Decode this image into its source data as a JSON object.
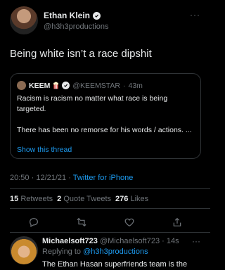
{
  "tweet": {
    "author_name": "Ethan Klein",
    "author_handle": "@h3h3productions",
    "more_icon": "more-icon",
    "text": "Being white isn’t a race dipshit",
    "quoted": {
      "author_name": "KEEM",
      "author_handle": "@KEEMSTAR",
      "separator": "·",
      "time": "43m",
      "line1": "Racism is racism no matter what race is being targeted.",
      "line2": "There has been no remorse for his words / actions. ...",
      "show_thread": "Show this thread"
    },
    "time": "20:50",
    "date": "12/21/21",
    "client": "Twitter for iPhone",
    "retweets_count": "15",
    "retweets_label": "Retweets",
    "quotes_count": "2",
    "quotes_label": "Quote Tweets",
    "likes_count": "276",
    "likes_label": "Likes"
  },
  "reply": {
    "author_name": "Michaelsoft723",
    "author_handle": "@Michaelsoft723",
    "time": "14s",
    "replying_prefix": "Replying to",
    "replying_to": "@h3h3productions",
    "text": "The Ethan Hasan superfriends team is the"
  },
  "colors": {
    "background": "#000000",
    "accent": "#1d9bf0",
    "muted": "#71767b",
    "text": "#e7e9ea"
  }
}
